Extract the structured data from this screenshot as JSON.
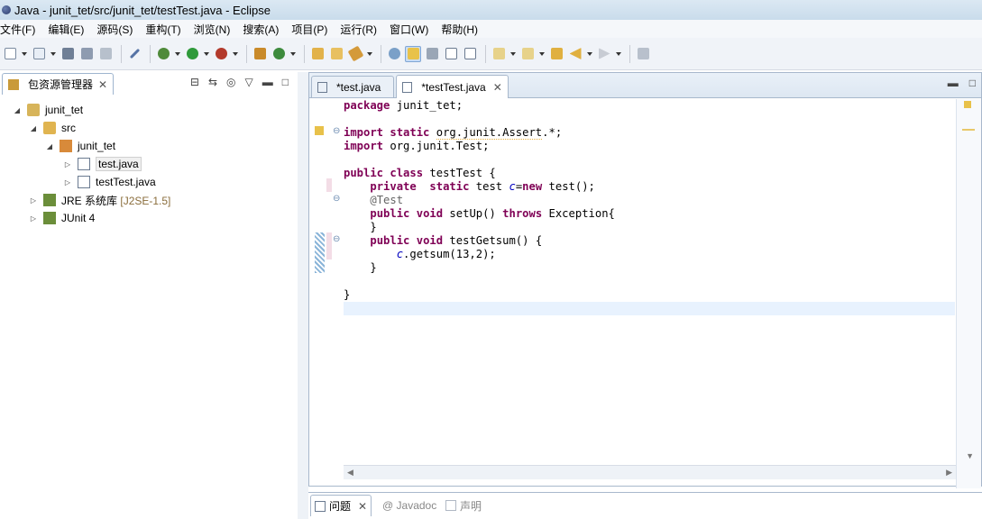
{
  "window": {
    "title": "Java - junit_tet/src/junit_tet/testTest.java - Eclipse"
  },
  "menu": [
    "文件(F)",
    "编辑(E)",
    "源码(S)",
    "重构(T)",
    "浏览(N)",
    "搜索(A)",
    "项目(P)",
    "运行(R)",
    "窗口(W)",
    "帮助(H)"
  ],
  "package_explorer": {
    "tab_label": "包资源管理器",
    "tree": [
      {
        "label": "junit_tet",
        "muted": ""
      },
      {
        "label": "src",
        "muted": ""
      },
      {
        "label": "junit_tet",
        "muted": ""
      },
      {
        "label": "test.java",
        "muted": ""
      },
      {
        "label": "testTest.java",
        "muted": ""
      },
      {
        "label": "JRE 系统库",
        "muted": "[J2SE-1.5]"
      },
      {
        "label": "JUnit 4",
        "muted": ""
      }
    ]
  },
  "editor": {
    "tabs": [
      {
        "label": "*test.java"
      },
      {
        "label": "*testTest.java"
      }
    ],
    "code_lines": [
      "package junit_tet;",
      "",
      "import static org.junit.Assert.*;",
      "import org.junit.Test;",
      "",
      "public class testTest {",
      "    private  static test c=new test();",
      "    @Test",
      "    public void setUp() throws Exception{",
      "    }",
      "    public void testGetsum() {",
      "        c.getsum(13,2);",
      "    }",
      "",
      "}",
      ""
    ]
  },
  "bottom_panel": {
    "tabs": [
      "问题",
      "@ Javadoc",
      "声明"
    ]
  }
}
